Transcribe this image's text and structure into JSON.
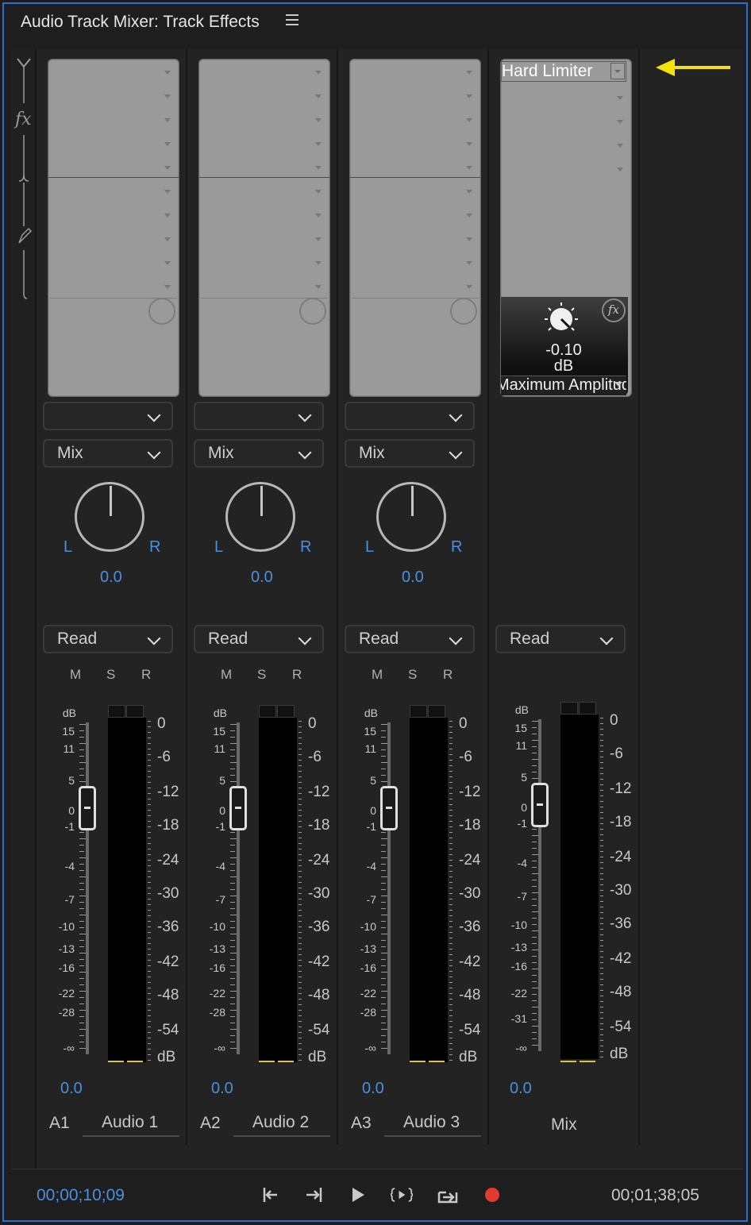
{
  "panel": {
    "title": "Audio Track Mixer: Track Effects"
  },
  "rail": {
    "fx_label": "fx"
  },
  "strips": [
    {
      "id": "A1",
      "name": "Audio 1",
      "send_selected": "",
      "route": "Mix",
      "pan": "0.0",
      "pan_L": "L",
      "pan_R": "R",
      "automation": "Read",
      "m": "M",
      "s": "S",
      "r": "R",
      "volume": "0.0"
    },
    {
      "id": "A2",
      "name": "Audio 2",
      "send_selected": "",
      "route": "Mix",
      "pan": "0.0",
      "pan_L": "L",
      "pan_R": "R",
      "automation": "Read",
      "m": "M",
      "s": "S",
      "r": "R",
      "volume": "0.0"
    },
    {
      "id": "A3",
      "name": "Audio 3",
      "send_selected": "",
      "route": "Mix",
      "pan": "0.0",
      "pan_L": "L",
      "pan_R": "R",
      "automation": "Read",
      "m": "M",
      "s": "S",
      "r": "R",
      "volume": "0.0"
    }
  ],
  "mix": {
    "name": "Mix",
    "automation": "Read",
    "volume": "0.0",
    "effect": {
      "name": "Hard Limiter",
      "value": "-0.10",
      "unit": "dB",
      "param": "Maximum Amplitude"
    }
  },
  "fader_scale": {
    "unit": "dB",
    "labels": [
      "15",
      "11",
      "5",
      "0",
      "-1",
      "-4",
      "-7",
      "-10",
      "-13",
      "-16",
      "-22",
      "-28",
      "-∞"
    ],
    "mix_labels": [
      "15",
      "11",
      "5",
      "0",
      "-1",
      "-4",
      "-7",
      "-10",
      "-13",
      "-16",
      "-22",
      "-31",
      "-∞"
    ]
  },
  "meter_scale": {
    "labels": [
      "0",
      "-6",
      "-12",
      "-18",
      "-24",
      "-30",
      "-36",
      "-42",
      "-48",
      "-54",
      "dB"
    ]
  },
  "transport": {
    "current_time": "00;00;10;09",
    "duration": "00;01;38;05"
  },
  "colors": {
    "accent": "#4a8fe0",
    "record": "#e23a32",
    "annotation": "#f5e10a"
  }
}
